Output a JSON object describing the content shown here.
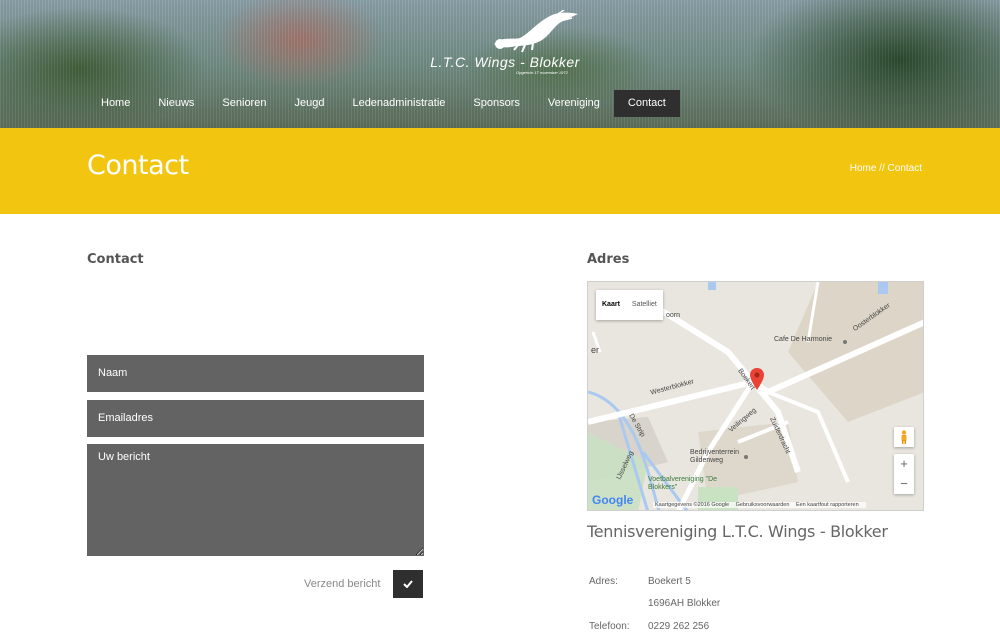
{
  "header": {
    "logo_title": "L.T.C. Wings - Blokker",
    "logo_subtitle": "Opgericht 17 november 1972",
    "nav": [
      {
        "label": "Home"
      },
      {
        "label": "Nieuws"
      },
      {
        "label": "Senioren"
      },
      {
        "label": "Jeugd"
      },
      {
        "label": "Ledenadministratie"
      },
      {
        "label": "Sponsors"
      },
      {
        "label": "Vereniging"
      },
      {
        "label": "Contact",
        "active": true
      }
    ]
  },
  "band": {
    "title": "Contact",
    "breadcrumb_home": "Home",
    "breadcrumb_sep": " // ",
    "breadcrumb_current": "Contact",
    "color": "#f2c511"
  },
  "contact": {
    "heading": "Contact",
    "name_placeholder": "Naam",
    "email_placeholder": "Emailadres",
    "message_placeholder": "Uw bericht",
    "send_label": "Verzend bericht"
  },
  "address": {
    "heading": "Adres",
    "map": {
      "tab_map": "Kaart",
      "tab_satellite": "Satelliet",
      "labels": [
        "Cafe De Harmonie",
        "Westerblokker",
        "Oosterblokker",
        "Boekert",
        "Zuiderdracht",
        "Veilingweg",
        "De Strip",
        "IJsselweg",
        "Bedrijventerrein Gildenweg",
        "Voetbalvereniging \"De Blokkers\"",
        "oorn",
        "er"
      ],
      "zoom_in": "+",
      "zoom_out": "−",
      "google": "Google",
      "attribution": [
        "Kaartgegevens ©2016 Google",
        "Gebruiksvoorwaarden",
        "Een kaartfout rapporteren"
      ]
    },
    "org_name": "Tennisvereniging L.T.C. Wings - Blokker",
    "lines": [
      {
        "label": "Adres:",
        "value": "Boekert 5"
      },
      {
        "label": "",
        "value": "1696AH Blokker"
      },
      {
        "label": "Telefoon:",
        "value": "0229 262 256"
      }
    ]
  }
}
